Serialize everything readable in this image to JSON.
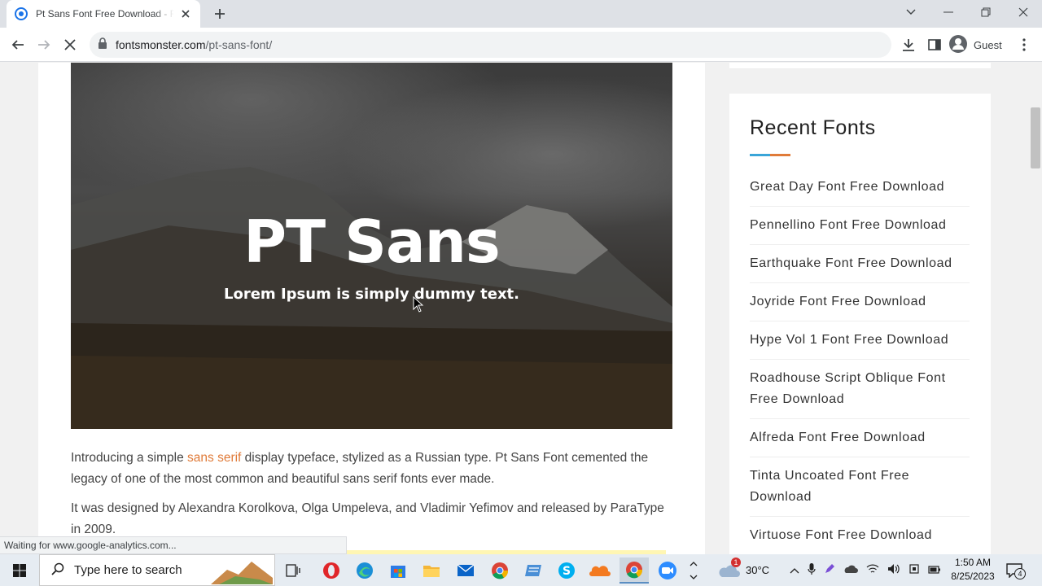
{
  "browser": {
    "tab_title": "Pt Sans Font Free Download - Fo",
    "url_host": "fontsmonster.com",
    "url_path": "/pt-sans-font/",
    "profile_label": "Guest",
    "status_text": "Waiting for www.google-analytics.com..."
  },
  "hero": {
    "title": "PT Sans",
    "subtitle": "Lorem Ipsum is simply dummy text."
  },
  "article": {
    "p1_before": "Introducing a simple ",
    "p1_link": "sans serif",
    "p1_after": " display typeface, stylized as a Russian type. Pt Sans Font cemented the legacy of one of the most common and beautiful sans serif fonts ever made.",
    "p2": "It was designed by Alexandra Korolkova, Olga Umpeleva, and Vladimir Yefimov and released by ParaType in 2009."
  },
  "sidebar": {
    "title": "Recent Fonts",
    "items": [
      "Great Day Font Free Download",
      "Pennellino Font Free Download",
      "Earthquake Font Free Download",
      "Joyride Font Free Download",
      "Hype Vol 1 Font Free Download",
      "Roadhouse Script Oblique Font Free Download",
      "Alfreda Font Free Download",
      "Tinta Uncoated Font Free Download",
      "Virtuose Font Free Download"
    ]
  },
  "taskbar": {
    "search_placeholder": "Type here to search",
    "temperature": "30°C",
    "time": "1:50 AM",
    "date": "8/25/2023",
    "notification_count": "4",
    "weather_badge": "1"
  },
  "colors": {
    "link_accent": "#e07b39",
    "accent_blue": "#3aa5d8"
  }
}
